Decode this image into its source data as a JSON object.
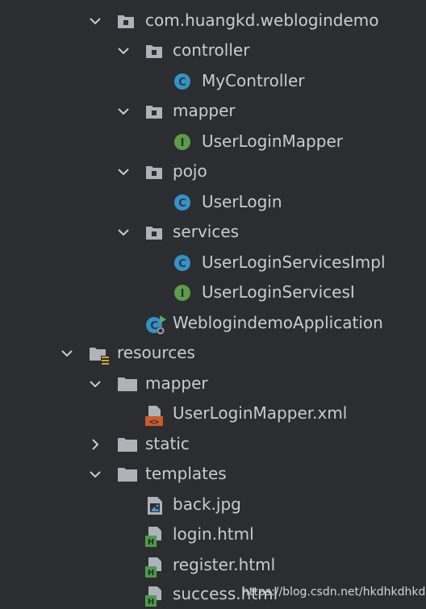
{
  "tree": {
    "items": [
      {
        "label": "com.huangkd.weblogindemo",
        "icon": "package-icon"
      },
      {
        "label": "controller",
        "icon": "package-icon"
      },
      {
        "label": "MyController",
        "icon": "class-icon"
      },
      {
        "label": "mapper",
        "icon": "package-icon"
      },
      {
        "label": "UserLoginMapper",
        "icon": "interface-icon"
      },
      {
        "label": "pojo",
        "icon": "package-icon"
      },
      {
        "label": "UserLogin",
        "icon": "class-icon"
      },
      {
        "label": "services",
        "icon": "package-icon"
      },
      {
        "label": "UserLoginServicesImpl",
        "icon": "class-icon"
      },
      {
        "label": "UserLoginServicesI",
        "icon": "interface-icon"
      },
      {
        "label": "WeblogindemoApplication",
        "icon": "spring-app-icon"
      },
      {
        "label": "resources",
        "icon": "resources-folder-icon"
      },
      {
        "label": "mapper",
        "icon": "folder-icon"
      },
      {
        "label": "UserLoginMapper.xml",
        "icon": "xml-file-icon"
      },
      {
        "label": "static",
        "icon": "folder-icon"
      },
      {
        "label": "templates",
        "icon": "folder-icon"
      },
      {
        "label": "back.jpg",
        "icon": "image-file-icon"
      },
      {
        "label": "login.html",
        "icon": "html-file-icon"
      },
      {
        "label": "register.html",
        "icon": "html-file-icon"
      },
      {
        "label": "success.html",
        "icon": "html-file-icon"
      }
    ]
  },
  "watermark": "https://blog.csdn.net/hkdhkdhkd",
  "colors": {
    "background": "#2b2d30",
    "text": "#c9ccd1",
    "folder": "#aeb3ba",
    "class": "#3592c4",
    "interface": "#5e9b4a",
    "xml": "#cc5a2b",
    "html_badge": "#4f9a4d"
  }
}
